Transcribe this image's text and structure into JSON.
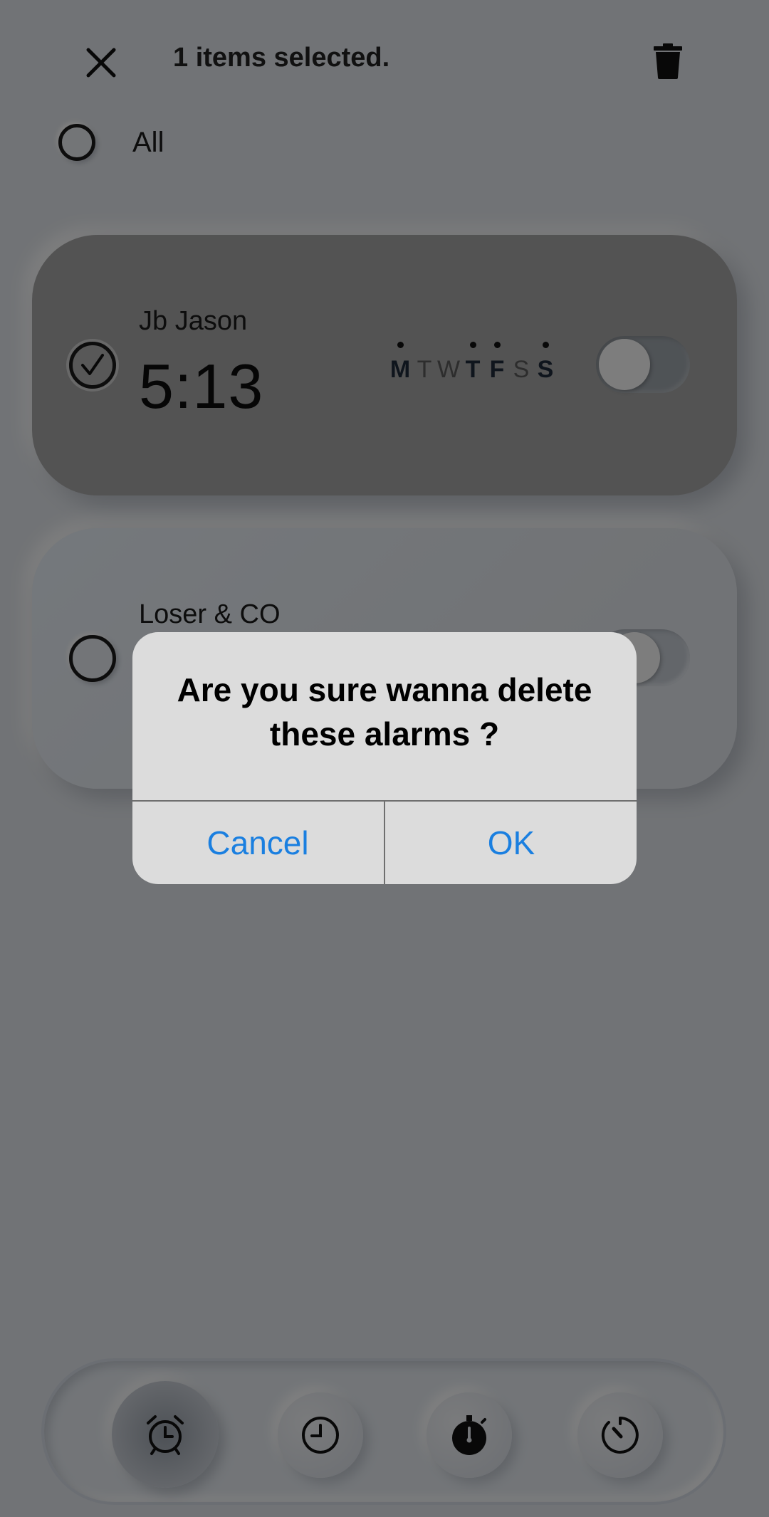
{
  "header": {
    "selection_text": "1 items selected."
  },
  "select_all": {
    "label": "All"
  },
  "alarms": [
    {
      "label": "Jb Jason",
      "time": "5:13",
      "selected": true,
      "enabled": false,
      "days": [
        {
          "letter": "M",
          "active": true
        },
        {
          "letter": "T",
          "active": false
        },
        {
          "letter": "W",
          "active": false
        },
        {
          "letter": "T",
          "active": true
        },
        {
          "letter": "F",
          "active": true
        },
        {
          "letter": "S",
          "active": false
        },
        {
          "letter": "S",
          "active": true
        }
      ]
    },
    {
      "label": "Loser & CO",
      "selected": false,
      "enabled": false
    }
  ],
  "dialog": {
    "message": "Are you sure wanna delete these alarms ?",
    "cancel_label": "Cancel",
    "ok_label": "OK",
    "accent_color": "#1a7fe0"
  },
  "bottom_nav": {
    "items": [
      {
        "icon": "alarm-clock-icon",
        "active": true
      },
      {
        "icon": "clock-icon",
        "active": false
      },
      {
        "icon": "stopwatch-icon",
        "active": false
      },
      {
        "icon": "timer-icon",
        "active": false
      }
    ]
  }
}
